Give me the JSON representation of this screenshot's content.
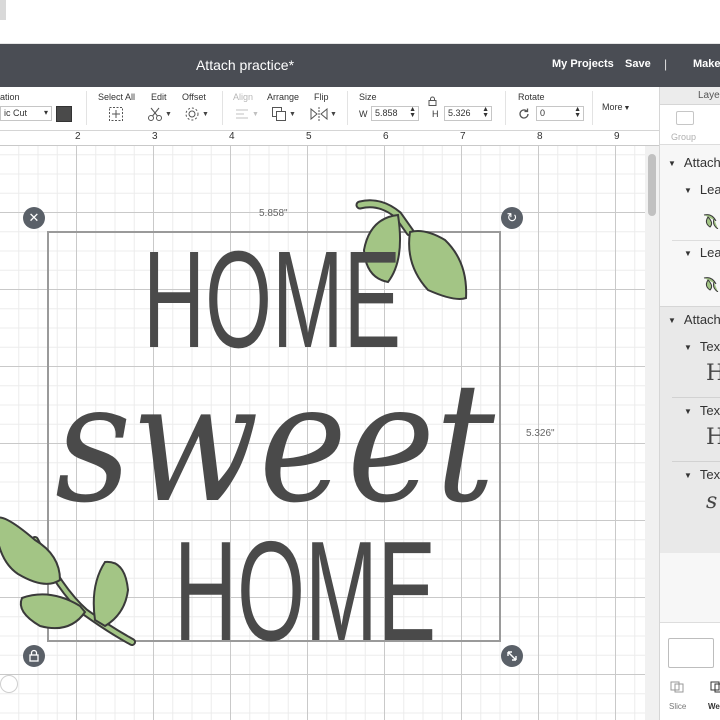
{
  "header": {
    "title": "Attach practice*",
    "my_projects": "My Projects",
    "save": "Save",
    "separator": "|",
    "make": "Make"
  },
  "toolbar": {
    "operation_label": "ation",
    "operation_value": "ic Cut",
    "select_all": "Select All",
    "edit": "Edit",
    "offset": "Offset",
    "align": "Align",
    "arrange": "Arrange",
    "flip": "Flip",
    "size": "Size",
    "w_label": "W",
    "w_value": "5.858",
    "h_label": "H",
    "h_value": "5.326",
    "rotate": "Rotate",
    "rotate_value": "0",
    "more": "More"
  },
  "ruler": [
    "2",
    "3",
    "4",
    "5",
    "6",
    "7",
    "8",
    "9"
  ],
  "canvas": {
    "width_dim": "5.858\"",
    "height_dim": "5.326\"",
    "artwork_words": [
      "HOME",
      "sweet",
      "HOME"
    ]
  },
  "layers": {
    "title": "Layers",
    "group": "Group",
    "rows": [
      {
        "label": "Attach",
        "indent": false
      },
      {
        "label": "Leaf",
        "indent": true
      },
      {
        "label": "Leaf",
        "indent": true
      },
      {
        "label": "Attach",
        "indent": false
      },
      {
        "label": "Text",
        "indent": true
      },
      {
        "label": "Text",
        "indent": true
      },
      {
        "label": "Text",
        "indent": true
      }
    ],
    "bottom": {
      "slice": "Slice",
      "weld": "Weld"
    }
  },
  "colors": {
    "header_bg": "#4a4d54",
    "text_fill": "#4a4a4a",
    "leaf_fill": "#a3c585",
    "selection": "#9a9a9a"
  }
}
